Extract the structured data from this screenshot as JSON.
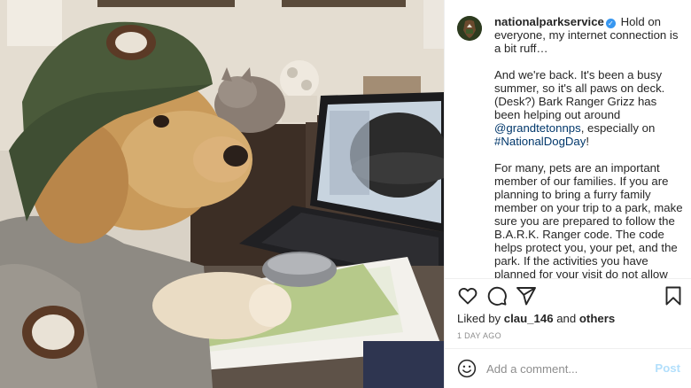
{
  "post": {
    "username": "nationalparkservice",
    "verified_icon": "verified-badge-icon",
    "caption_first": "Hold on everyone, my internet connection is a bit ruff…",
    "caption_p2_a": "And we're back. It's been a busy summer, so it's all paws on deck. (Desk?) Bark Ranger Grizz has been helping out around ",
    "caption_p2_mention": "@grandtetonnps",
    "caption_p2_b": ", especially on ",
    "caption_p2_hashtag": "#NationalDogDay",
    "caption_p2_c": "!",
    "caption_p3": "For many, pets are an important member of our families. If you are planning to bring a furry family member on your trip to a park, make sure you are prepared to follow the B.A.R.K. Ranger code. The code helps protect you, your pet, and the park. If the activities you have planned for your visit do not allow for pets or are unsafe, consider leaving them at home."
  },
  "actions": {
    "like_icon": "heart-icon",
    "comment_icon": "comment-icon",
    "share_icon": "share-icon",
    "save_icon": "bookmark-icon"
  },
  "likes": {
    "prefix": "Liked by ",
    "user": "clau_146",
    "middle": " and ",
    "others": "others"
  },
  "timestamp": "1 DAY AGO",
  "comment": {
    "emoji_icon": "emoji-icon",
    "placeholder": "Add a comment...",
    "post_label": "Post"
  },
  "colors": {
    "link": "#00376b",
    "verified": "#3897f0",
    "post_button": "#b2dffc",
    "muted": "#8e8e8e"
  }
}
